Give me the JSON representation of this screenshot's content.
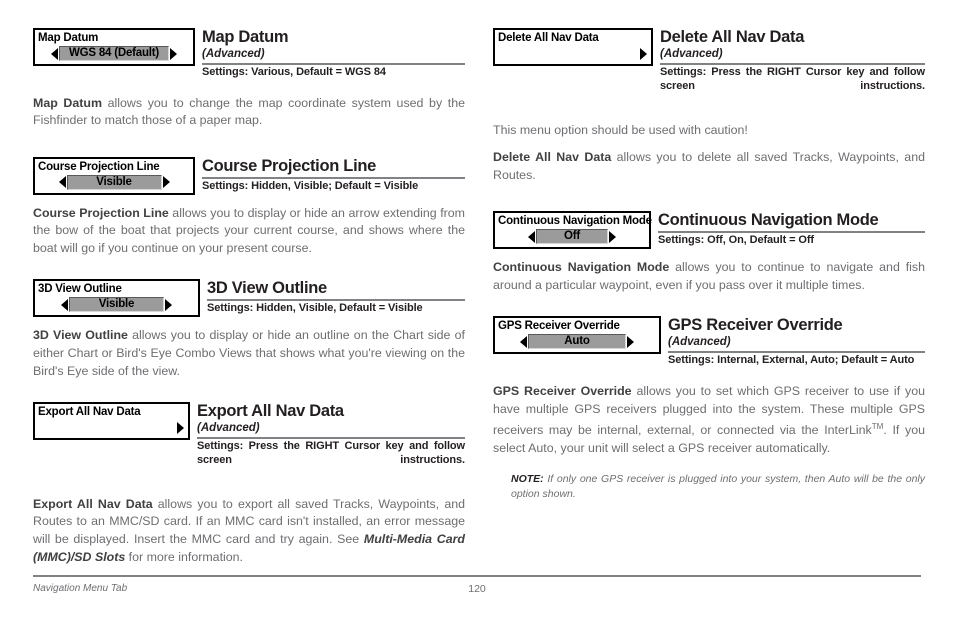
{
  "document": {
    "footer_section": "Navigation Menu Tab",
    "page_number": "120"
  },
  "left_column": {
    "entries": [
      {
        "id": "map-datum",
        "widget": {
          "title": "Map Datum",
          "value": "WGS 84 (Default)",
          "has_left_arrow": true,
          "has_right_arrow": true
        },
        "heading": "Map Datum",
        "advanced": "(Advanced)",
        "settings": "Settings: Various, Default = WGS 84",
        "body_lead": "Map Datum",
        "body_rest": " allows you to change the map coordinate system used by the Fishfinder to match those of a paper map."
      },
      {
        "id": "course-projection-line",
        "widget": {
          "title": "Course Projection Line",
          "value": "Visible",
          "has_left_arrow": true,
          "has_right_arrow": true
        },
        "heading": "Course Projection Line",
        "advanced": "",
        "settings": "Settings: Hidden, Visible; Default = Visible",
        "body_lead": "Course Projection Line",
        "body_rest": " allows you to display or hide an arrow extending from the bow of the boat that projects your current course, and shows where the boat will go if you continue on your present course."
      },
      {
        "id": "3d-view-outline",
        "widget": {
          "title": "3D View Outline",
          "value": "Visible",
          "has_left_arrow": true,
          "has_right_arrow": true
        },
        "heading": "3D View Outline",
        "advanced": "",
        "settings": "Settings: Hidden, Visible, Default = Visible",
        "body_lead": "3D View Outline",
        "body_rest": " allows you to display or hide an outline on the Chart side of either Chart or Bird's Eye Combo Views that shows what you're viewing on the Bird's Eye side of the view."
      },
      {
        "id": "export-all-nav-data",
        "widget": {
          "title": "Export All Nav Data",
          "value": "",
          "has_left_arrow": false,
          "has_right_arrow": true
        },
        "heading": "Export All Nav Data",
        "advanced": "(Advanced)",
        "settings": "Settings: Press the RIGHT Cursor key and follow screen instructions.",
        "body_lead": "Export All Nav Data",
        "body_rest_1": " allows you to export all saved Tracks, Waypoints, and Routes to an MMC/SD card. If an MMC card isn't installed, an error message will be displayed. Insert the MMC card and try again. See ",
        "body_italic": "Multi-Media Card (MMC)/SD Slots",
        "body_rest_2": " for more information."
      }
    ]
  },
  "right_column": {
    "entries": [
      {
        "id": "delete-all-nav-data",
        "widget": {
          "title": "Delete All Nav Data",
          "value": "",
          "has_left_arrow": false,
          "has_right_arrow": true
        },
        "heading": "Delete All Nav Data",
        "advanced": "(Advanced)",
        "settings": "Settings: Press the RIGHT Cursor key and follow screen instructions.",
        "caution": "This menu option should be used with caution!",
        "body_lead": "Delete All Nav Data",
        "body_rest": " allows you to delete all saved Tracks, Waypoints, and Routes."
      },
      {
        "id": "continuous-navigation-mode",
        "widget": {
          "title": "Continuous Navigation Mode",
          "value": "Off",
          "has_left_arrow": true,
          "has_right_arrow": true
        },
        "heading": "Continuous Navigation Mode",
        "advanced": "",
        "settings": "Settings: Off, On, Default = Off",
        "body_lead": "Continuous Navigation Mode",
        "body_rest": " allows you to continue to navigate and fish around a particular waypoint, even if you pass over it multiple times."
      },
      {
        "id": "gps-receiver-override",
        "widget": {
          "title": "GPS Receiver Override",
          "value": "Auto",
          "has_left_arrow": true,
          "has_right_arrow": true
        },
        "heading": "GPS Receiver Override",
        "advanced": "(Advanced)",
        "settings": "Settings: Internal, External, Auto; Default = Auto",
        "body_lead": "GPS Receiver Override",
        "body_rest_1": " allows you to set which GPS receiver to use if you have multiple GPS receivers plugged into the system. These multiple GPS receivers may be internal, external, or connected via the InterLink",
        "body_trademark": "TM",
        "body_rest_2": ". If you select Auto, your unit will select a GPS receiver automatically.",
        "note_label": "NOTE:",
        "note_text": " If only one GPS receiver is plugged into your system, then Auto will be the only option shown."
      }
    ]
  }
}
